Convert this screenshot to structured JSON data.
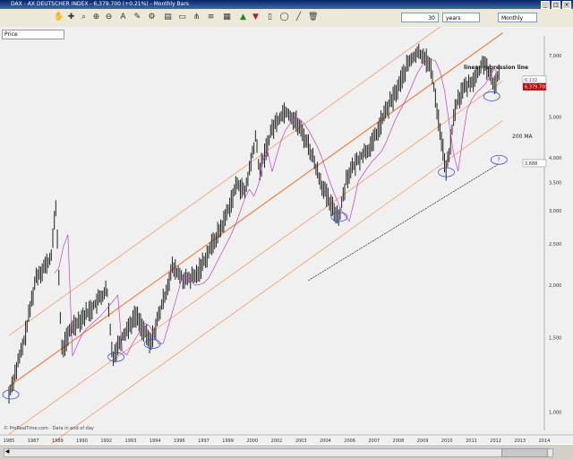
{
  "window": {
    "title": "DAX - AX DEUTSCHER INDEX - 6,379.700 (+0.21%) - Monthly Bars"
  },
  "toolbar": {
    "period_value": "30",
    "period_unit": "years",
    "interval": "Monthly",
    "icons": [
      "hand-icon",
      "cross-icon",
      "magnify-icon",
      "zoom-in-icon",
      "zoom-out-icon",
      "text-icon",
      "pen-icon",
      "gear-icon",
      "chart-icon",
      "ruler-icon",
      "fork-icon",
      "fibonacci-icon",
      "calendar-icon",
      "up-arrow-icon",
      "down-arrow-icon",
      "rectangle-icon",
      "ellipse-icon",
      "line-icon",
      "trash-icon"
    ]
  },
  "chart": {
    "price_label": "Price",
    "watermark": "© ProRealTime.com · Data in end of day",
    "annotation_lr": "linear regression line",
    "annotation_ma": "200 MA",
    "question_mark": "?",
    "price_tags": {
      "upper": "6,132",
      "current": "6,379.700",
      "ma": "3,888"
    }
  },
  "chart_data": {
    "type": "line",
    "title": "",
    "xlabel": "",
    "ylabel": "",
    "x_ticks": [
      "1985",
      "1987",
      "1989",
      "1990",
      "1992",
      "1993",
      "1994",
      "1996",
      "1997",
      "1999",
      "2000",
      "2002",
      "2003",
      "2004",
      "2006",
      "2007",
      "2008",
      "2009",
      "2010",
      "2011",
      "2012",
      "2013",
      "2014"
    ],
    "y_ticks": [
      "7,000",
      "5,000",
      "4,000",
      "3,500",
      "3,000",
      "2,500",
      "2,000",
      "1,500",
      "1,000"
    ],
    "grid": false,
    "series": [
      {
        "values": [
          [
            1985.0,
            1100
          ],
          [
            1985.8,
            1450
          ],
          [
            1986.5,
            2100
          ],
          [
            1987.3,
            2300
          ],
          [
            1987.6,
            3100
          ],
          [
            1987.9,
            1400
          ],
          [
            1988.5,
            1600
          ],
          [
            1989.5,
            1750
          ],
          [
            1990.4,
            1950
          ],
          [
            1990.7,
            1350
          ],
          [
            1991.2,
            1500
          ],
          [
            1992.0,
            1700
          ],
          [
            1992.8,
            1450
          ],
          [
            1993.6,
            1900
          ],
          [
            1994.0,
            2200
          ],
          [
            1994.7,
            2050
          ],
          [
            1995.3,
            2100
          ],
          [
            1996.0,
            2400
          ],
          [
            1996.8,
            2800
          ],
          [
            1997.6,
            3500
          ],
          [
            1998.0,
            3300
          ],
          [
            1998.6,
            4500
          ],
          [
            1998.8,
            3700
          ],
          [
            1999.5,
            4700
          ],
          [
            2000.2,
            5200
          ],
          [
            2000.8,
            4900
          ],
          [
            2001.5,
            4300
          ],
          [
            2002.2,
            3500
          ],
          [
            2002.7,
            3100
          ],
          [
            2003.2,
            2900
          ],
          [
            2003.6,
            3600
          ],
          [
            2004.3,
            4000
          ],
          [
            2005.0,
            4300
          ],
          [
            2005.7,
            5100
          ],
          [
            2006.3,
            5700
          ],
          [
            2007.0,
            6700
          ],
          [
            2007.5,
            7100
          ],
          [
            2007.9,
            7000
          ],
          [
            2008.3,
            6400
          ],
          [
            2008.8,
            4500
          ],
          [
            2009.1,
            3700
          ],
          [
            2009.6,
            5300
          ],
          [
            2010.0,
            5800
          ],
          [
            2010.7,
            6200
          ],
          [
            2011.2,
            6800
          ],
          [
            2011.7,
            5900
          ],
          [
            2012.0,
            6379
          ]
        ]
      }
    ]
  }
}
